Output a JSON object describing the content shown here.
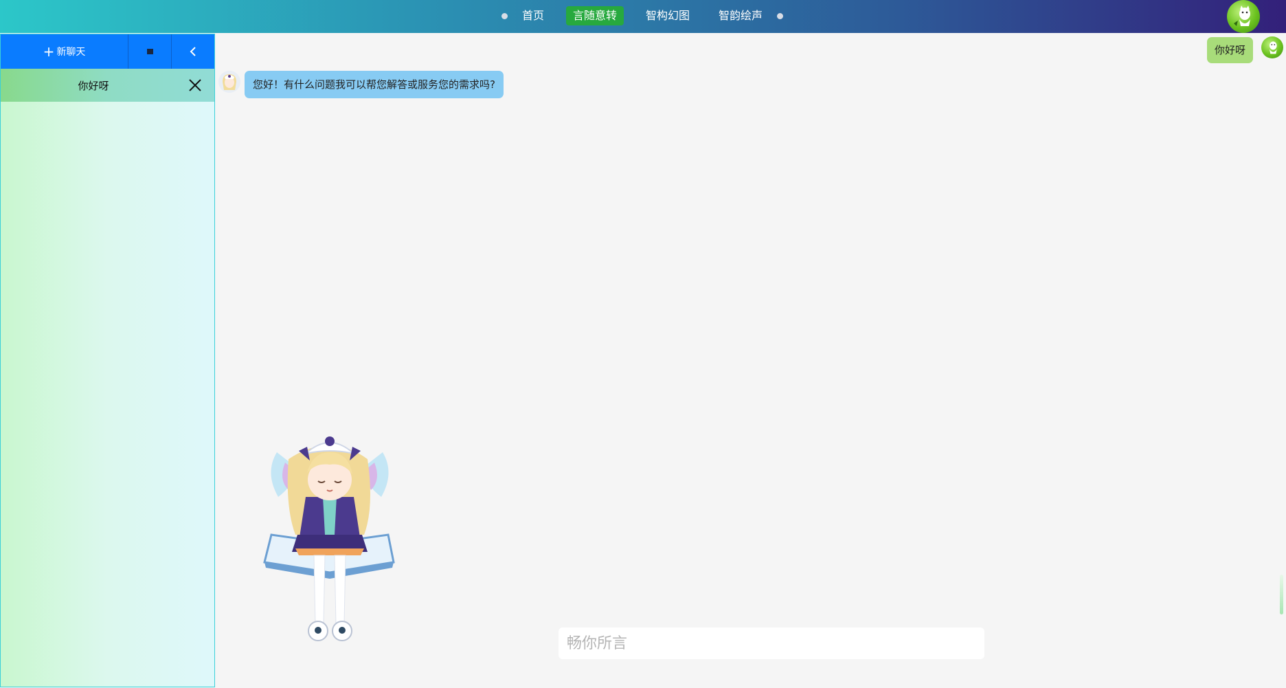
{
  "nav": {
    "items": [
      {
        "label": "首页",
        "active": false
      },
      {
        "label": "言随意转",
        "active": true
      },
      {
        "label": "智构幻图",
        "active": false
      },
      {
        "label": "智韵绘声",
        "active": false
      }
    ]
  },
  "sidebar": {
    "new_chat_label": "新聊天",
    "conversations": [
      {
        "title": "你好呀"
      }
    ]
  },
  "chat": {
    "messages": [
      {
        "role": "user",
        "text": "你好呀"
      },
      {
        "role": "assistant",
        "text": "您好！有什么问题我可以帮您解答或服务您的需求吗?"
      }
    ]
  },
  "input": {
    "placeholder": "畅你所言",
    "value": ""
  },
  "colors": {
    "accent_blue": "#0a7cff",
    "nav_active": "#27a93e",
    "user_bubble": "#a8dc7a",
    "bot_bubble": "#87cbf3"
  },
  "icons": {
    "new_chat": "plus-icon",
    "grid": "square-icon",
    "back": "chevron-left-icon",
    "close": "close-icon"
  }
}
